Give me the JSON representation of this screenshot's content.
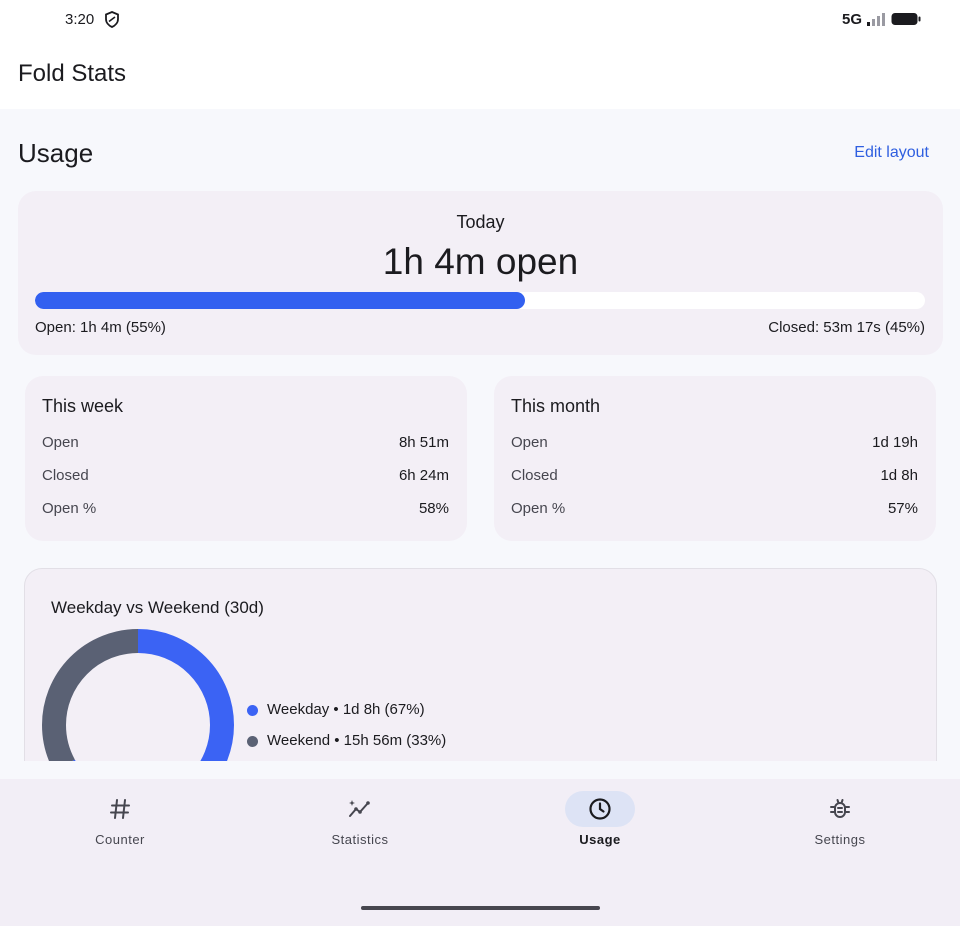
{
  "status_bar": {
    "time": "3:20",
    "network": "5G",
    "icons": [
      "shield-icon",
      "signal-icon",
      "battery-icon"
    ]
  },
  "app": {
    "title": "Fold Stats"
  },
  "page": {
    "title": "Usage",
    "edit_layout_label": "Edit layout"
  },
  "today": {
    "label": "Today",
    "value": "1h 4m open",
    "open_fraction": 0.55,
    "open_text": "Open: 1h 4m (55%)",
    "closed_text": "Closed: 53m 17s (45%)"
  },
  "week": {
    "title": "This week",
    "rows": [
      {
        "label": "Open",
        "value": "8h 51m"
      },
      {
        "label": "Closed",
        "value": "6h 24m"
      },
      {
        "label": "Open %",
        "value": "58%"
      }
    ]
  },
  "month": {
    "title": "This month",
    "rows": [
      {
        "label": "Open",
        "value": "1d 19h"
      },
      {
        "label": "Closed",
        "value": "1d 8h"
      },
      {
        "label": "Open %",
        "value": "57%"
      }
    ]
  },
  "weekday_weekend": {
    "title": "Weekday vs Weekend (30d)",
    "legend": [
      {
        "text": "Weekday • 1d 8h (67%)",
        "color": "#3b63f4",
        "fraction": 0.67
      },
      {
        "text": "Weekend • 15h 56m (33%)",
        "color": "#5a6174",
        "fraction": 0.33
      }
    ]
  },
  "bottom_nav": {
    "items": [
      {
        "label": "Counter",
        "icon": "hash-icon",
        "active": false
      },
      {
        "label": "Statistics",
        "icon": "trend-sparkle-icon",
        "active": false
      },
      {
        "label": "Usage",
        "icon": "clock-icon",
        "active": true
      },
      {
        "label": "Settings",
        "icon": "bug-gear-icon",
        "active": false
      }
    ]
  },
  "colors": {
    "accent": "#3260f0",
    "card_background": "#f3eff6",
    "nav_active_pill": "#dde3f5"
  }
}
